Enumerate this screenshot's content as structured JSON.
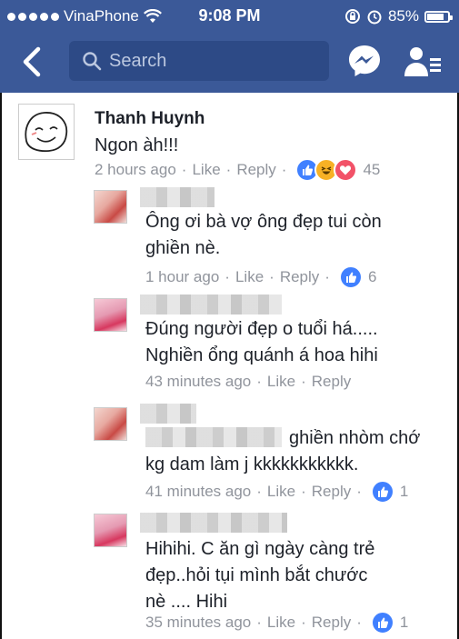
{
  "status": {
    "carrier": "VinaPhone",
    "time": "9:08 PM",
    "battery_label": "85%",
    "battery_level": 0.85
  },
  "nav": {
    "search_placeholder": "Search",
    "accent": "#3b5998"
  },
  "comments": [
    {
      "name": "Thanh Huynh",
      "text": "Ngon àh!!!",
      "time": "2 hours ago",
      "like": "Like",
      "reply": "Reply",
      "reactions": [
        "like-icon",
        "haha-icon",
        "love-icon"
      ],
      "count": "45"
    },
    {
      "text": "Ông ơi bà vợ ông đẹp tui còn\nghiền nè.",
      "time": "1 hour ago",
      "like": "Like",
      "reply": "Reply",
      "reactions": [
        "like-icon"
      ],
      "count": "6"
    },
    {
      "text": "Đúng người đẹp o tuổi há.....\nNghiền ổng quánh á hoa hihi",
      "time": "43 minutes ago",
      "like": "Like",
      "reply": "Reply"
    },
    {
      "text": "ghiền nhòm chớ\nkg dam làm j kkkkkkkkkkk.",
      "time": "41 minutes ago",
      "like": "Like",
      "reply": "Reply",
      "reactions": [
        "like-icon"
      ],
      "count": "1"
    },
    {
      "text": "Hihihi. C ăn gì ngày càng trẻ\nđẹp..hỏi tụi mình bắt chước\nnè .... Hihi",
      "time": "35 minutes ago",
      "like": "Like",
      "reply": "Reply",
      "reactions": [
        "like-icon"
      ],
      "count": "1"
    }
  ]
}
